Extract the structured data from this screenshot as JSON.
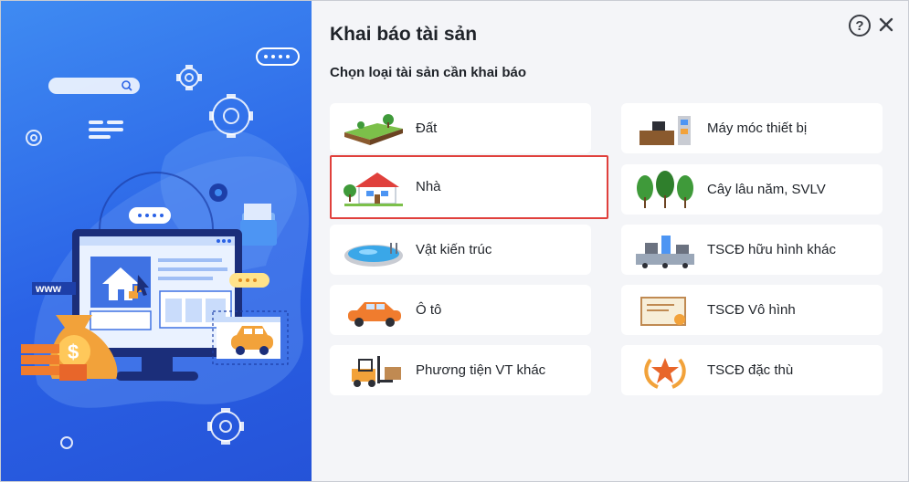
{
  "dialog": {
    "title": "Khai báo tài sản",
    "subtitle": "Chọn loại tài sản cần khai báo",
    "help_label": "?"
  },
  "illustration": {
    "www_label": "www",
    "currency_symbol": "$"
  },
  "asset_types": {
    "left": [
      {
        "label": "Đất",
        "icon": "land-icon"
      },
      {
        "label": "Nhà",
        "icon": "house-icon",
        "selected": true
      },
      {
        "label": "Vật kiến trúc",
        "icon": "pool-icon"
      },
      {
        "label": "Ô tô",
        "icon": "car-icon"
      },
      {
        "label": "Phương tiện VT khác",
        "icon": "forklift-icon"
      }
    ],
    "right": [
      {
        "label": "Máy móc thiết bị",
        "icon": "office-equipment-icon"
      },
      {
        "label": "Cây lâu năm, SVLV",
        "icon": "trees-icon"
      },
      {
        "label": "TSCĐ hữu hình khác",
        "icon": "machinery-icon"
      },
      {
        "label": "TSCĐ Vô hình",
        "icon": "certificate-icon"
      },
      {
        "label": "TSCĐ đặc thù",
        "icon": "award-badge-icon"
      }
    ]
  },
  "colors": {
    "panel_bg": "#f4f5f8",
    "illustration_blue": "#2a62e6",
    "selection_border": "#e0403c"
  }
}
